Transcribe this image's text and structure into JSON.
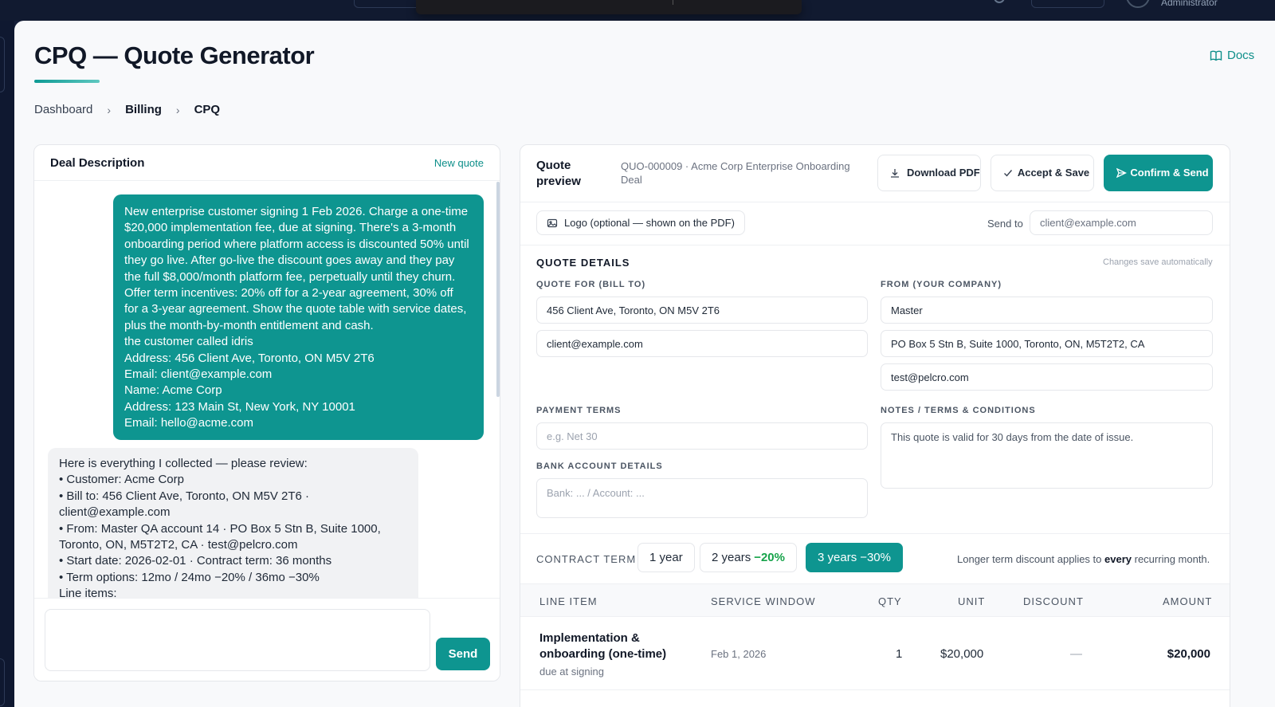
{
  "topbar": {
    "role": "Administrator"
  },
  "header": {
    "title": "CPQ — Quote Generator",
    "docs_label": "Docs"
  },
  "breadcrumb": [
    "Dashboard",
    "Billing",
    "CPQ"
  ],
  "chat_panel": {
    "title": "Deal Description",
    "new_quote_label": "New quote",
    "user_message": [
      "New enterprise customer signing 1 Feb 2026. Charge a one-time",
      "$20,000 implementation fee, due at signing. There's a 3-month",
      "onboarding period where platform access is discounted 50% until",
      "they go live. After go-live the discount goes away and they pay",
      "the full $8,000/month platform fee, perpetually until they churn.",
      "Offer term incentives: 20% off for a 2-year agreement, 30% off",
      "for a 3-year agreement. Show the quote table with service dates,",
      "plus the month-by-month entitlement and cash.",
      "the customer called idris",
      "Address: 456 Client Ave, Toronto, ON M5V 2T6",
      "Email: client@example.com",
      "Name: Acme Corp",
      "Address: 123 Main St, New York, NY 10001",
      "Email: hello@acme.com"
    ],
    "assistant_message": [
      "Here is everything I collected — please review:",
      "• Customer: Acme Corp",
      "• Bill to: 456 Client Ave, Toronto, ON M5V 2T6 ·",
      "client@example.com",
      "• From: Master QA account 14 · PO Box 5 Stn B, Suite 1000,",
      "Toronto, ON, M5T2T2, CA · test@pelcro.com",
      "• Start date: 2026-02-01 · Contract term: 36 months",
      "• Term options: 12mo / 24mo −20% / 36mo −30%",
      "Line items:"
    ],
    "composer_placeholder": "",
    "send_label": "Send"
  },
  "quote_preview": {
    "title": "Quote preview",
    "quote_id": "QUO-000009 · Acme Corp Enterprise Onboarding Deal",
    "download_label": "Download PDF",
    "accept_label": "Accept & Save",
    "confirm_label": "Confirm & Send",
    "logo_label": "Logo (optional — shown on the PDF)",
    "send_to_label": "Send to",
    "send_to_placeholder": "client@example.com",
    "details_title": "QUOTE DETAILS",
    "autosave_note": "Changes save automatically",
    "bill_to_label": "QUOTE FOR (BILL TO)",
    "bill_to_address": "456 Client Ave, Toronto, ON M5V 2T6",
    "bill_to_email": "client@example.com",
    "from_label": "FROM (YOUR COMPANY)",
    "from_name": "Master",
    "from_address": "PO Box 5 Stn B, Suite 1000, Toronto, ON, M5T2T2, CA",
    "from_email": "test@pelcro.com",
    "payment_terms_label": "PAYMENT TERMS",
    "payment_terms_placeholder": "e.g. Net 30",
    "bank_label": "BANK ACCOUNT DETAILS",
    "bank_placeholder": "Bank: ... / Account: ...",
    "notes_label": "NOTES / TERMS & CONDITIONS",
    "notes_value": "This quote is valid for 30 days from the date of issue.",
    "contract_term_label": "CONTRACT TERM",
    "terms": [
      {
        "label": "1 year",
        "discount": "",
        "active": false
      },
      {
        "label": "2 years",
        "discount": "−20%",
        "active": false
      },
      {
        "label": "3 years",
        "discount": "−30%",
        "active": true
      }
    ],
    "term_note_pre": "Longer term discount applies to",
    "term_note_bold": "every",
    "term_note_post": "recurring month.",
    "table_headers": [
      "LINE ITEM",
      "SERVICE WINDOW",
      "QTY",
      "UNIT",
      "DISCOUNT",
      "AMOUNT"
    ],
    "rows": [
      {
        "item": "Implementation & onboarding (one-time)",
        "sub": "due at signing",
        "window": "Feb 1, 2026",
        "qty": "1",
        "unit": "$20,000",
        "discount": "—",
        "amount": "$20,000"
      }
    ]
  },
  "colors": {
    "accent": "#0e9590",
    "discount_green": "#16a34a",
    "page_bg": "#f8f9fb",
    "frame": "#16203a"
  }
}
